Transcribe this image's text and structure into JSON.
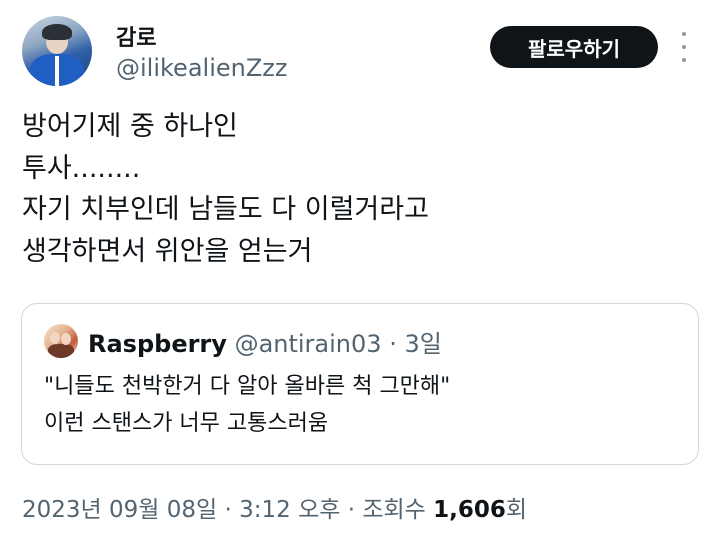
{
  "tweet": {
    "author": {
      "display_name": "감로",
      "handle": "@ilikealienZzz",
      "avatar_icon": "profile-avatar"
    },
    "follow_label": "팔로우하기",
    "more_icon": "more-vertical-icon",
    "text_lines": [
      "방어기제 중 하나인",
      "투사........",
      "자기 치부인데 남들도 다 이럴거라고",
      "생각하면서 위안을 얻는거"
    ],
    "quote": {
      "display_name": "Raspberry",
      "handle": "@antirain03",
      "separator": " · ",
      "time_ago": "3일",
      "text_lines": [
        "\"니들도 천박한거 다 알아 올바른 척 그만해\"",
        "이런 스탠스가 너무 고통스러움"
      ]
    },
    "meta": {
      "date": "2023년 09월 08일",
      "separator": " · ",
      "time": "3:12 오후",
      "views_label_prefix": "조회수 ",
      "views_count": "1,606",
      "views_label_suffix": "회"
    }
  },
  "colors": {
    "text_primary": "#0f1419",
    "text_secondary": "#536471",
    "button_bg": "#0f1419",
    "button_text": "#ffffff",
    "border": "#cfd9de"
  }
}
